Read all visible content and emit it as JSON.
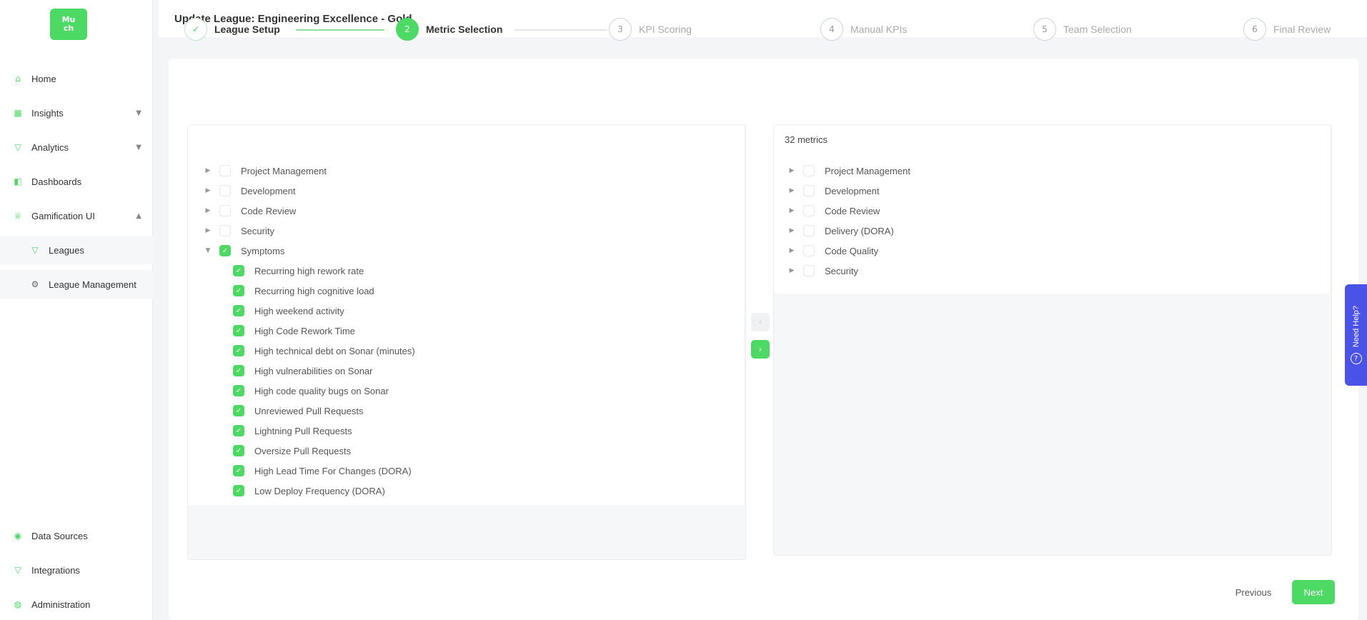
{
  "app": {
    "logo_line1": "Mu",
    "logo_line2": "ch"
  },
  "sidebar": {
    "items": [
      {
        "label": "Home",
        "icon": "home-icon"
      },
      {
        "label": "Insights",
        "icon": "chart-icon",
        "expandable": true
      },
      {
        "label": "Analytics",
        "icon": "funnel-icon",
        "expandable": true
      },
      {
        "label": "Dashboards",
        "icon": "dashboard-icon"
      },
      {
        "label": "Gamification UI",
        "icon": "trophy-icon",
        "expandable": true,
        "expanded": true
      },
      {
        "label": "Leagues",
        "icon": "funnel-icon",
        "sub": true
      },
      {
        "label": "League Management",
        "icon": "gear-icon",
        "sub": true
      },
      {
        "label": "Data Sources",
        "icon": "database-icon"
      },
      {
        "label": "Integrations",
        "icon": "plug-icon"
      },
      {
        "label": "Administration",
        "icon": "admin-icon"
      }
    ]
  },
  "header": {
    "title": "Update League: Engineering Excellence - Gold"
  },
  "stepper": {
    "steps": [
      {
        "num": "1",
        "label": "League Setup",
        "state": "done",
        "mark": "✓"
      },
      {
        "num": "2",
        "label": "Metric Selection",
        "state": "active",
        "mark": "2"
      },
      {
        "num": "3",
        "label": "KPI Scoring",
        "state": "pending",
        "mark": "3"
      },
      {
        "num": "4",
        "label": "Manual KPIs",
        "state": "pending",
        "mark": "4"
      },
      {
        "num": "5",
        "label": "Team Selection",
        "state": "pending",
        "mark": "5"
      },
      {
        "num": "6",
        "label": "Final Review",
        "state": "pending",
        "mark": "6"
      }
    ]
  },
  "left_panel": {
    "groups": [
      {
        "label": "Project Management",
        "expanded": false,
        "checked": false
      },
      {
        "label": "Development",
        "expanded": false,
        "checked": false
      },
      {
        "label": "Code Review",
        "expanded": false,
        "checked": false
      },
      {
        "label": "Security",
        "expanded": false,
        "checked": false
      },
      {
        "label": "Symptoms",
        "expanded": true,
        "checked": true
      }
    ],
    "children": [
      "Recurring high rework rate",
      "Recurring high cognitive load",
      "High weekend activity",
      "High Code Rework Time",
      "High technical debt on Sonar (minutes)",
      "High vulnerabilities on Sonar",
      "High code quality bugs on Sonar",
      "Unreviewed Pull Requests",
      "Lightning Pull Requests",
      "Oversize Pull Requests",
      "High Lead Time For Changes (DORA)",
      "Low Deploy Frequency (DORA)"
    ]
  },
  "right_panel": {
    "title": "32 metrics",
    "groups": [
      "Project Management",
      "Development",
      "Code Review",
      "Delivery (DORA)",
      "Code Quality",
      "Security"
    ]
  },
  "transfer": {
    "left_arrow": "‹",
    "right_arrow": "›"
  },
  "footer": {
    "previous_label": "Previous",
    "next_label": "Next"
  },
  "help": {
    "label": "Need Help?",
    "icon": "?"
  },
  "colors": {
    "accent": "#4cd964",
    "help": "#4a52e8"
  }
}
